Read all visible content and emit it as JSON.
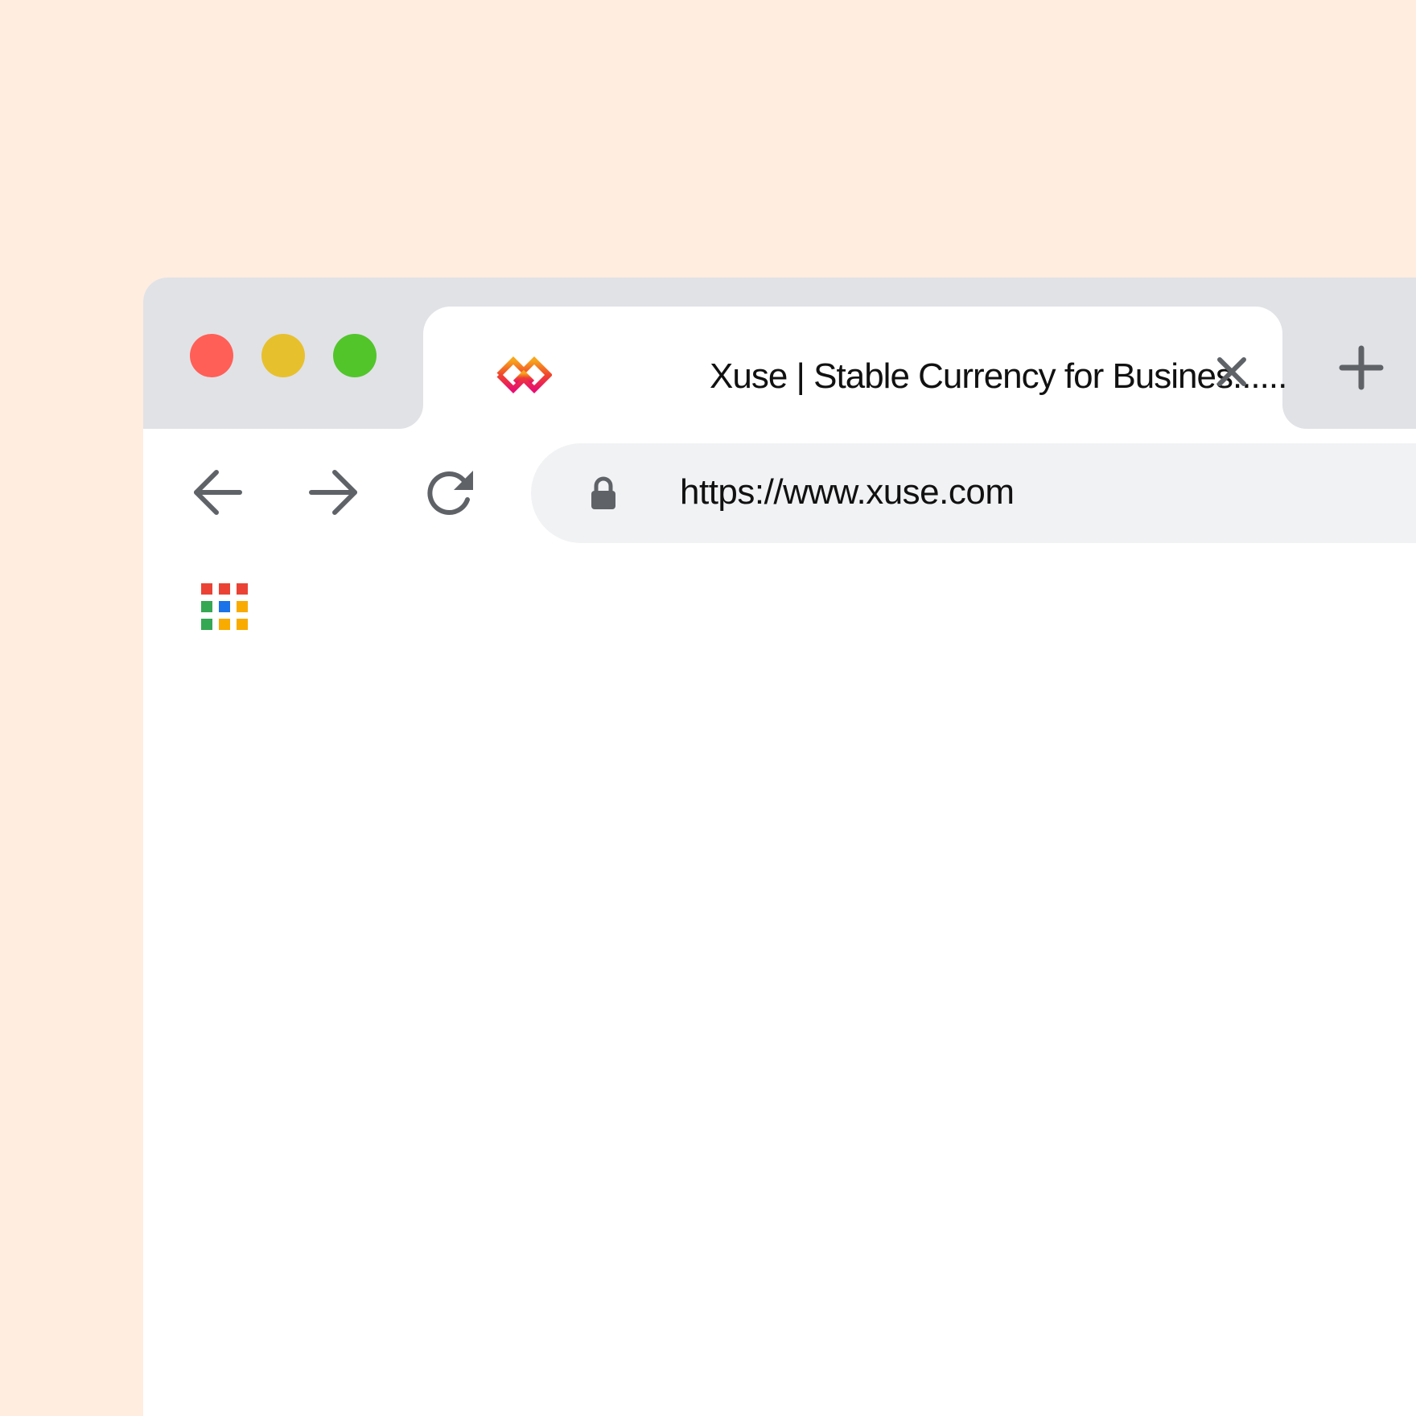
{
  "tab": {
    "title": "Xuse | Stable Currency for Busines......",
    "favicon": "xuse-logo-icon",
    "close_icon": "close-icon"
  },
  "new_tab": {
    "icon": "plus-icon"
  },
  "window_controls": {
    "close_color": "#FF5F57",
    "minimize_color": "#E7C02D",
    "maximize_color": "#52C52B"
  },
  "toolbar": {
    "back_icon": "arrow-left-icon",
    "forward_icon": "arrow-right-icon",
    "reload_icon": "reload-icon"
  },
  "address_bar": {
    "lock_icon": "lock-icon",
    "url": "https://www.xuse.com"
  },
  "bookmarks": {
    "apps_icon": "apps-grid-icon"
  },
  "colors": {
    "background": "#FFEDE0",
    "tabstrip": "#E1E2E6",
    "omnibox": "#F1F2F4",
    "icon_gray": "#5F6368"
  }
}
